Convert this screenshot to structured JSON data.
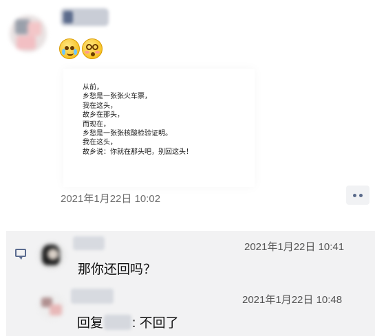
{
  "post": {
    "avatar_icon": "user-avatar-icon",
    "emojis": [
      "crying-face-icon",
      "dizzy-face-icon"
    ],
    "poem_lines": [
      "从前，",
      "乡愁是一张张火车票，",
      "我在这头，",
      "故乡在那头，",
      "而现在，",
      "乡愁是一张张核酸检验证明。",
      "我在这头，",
      "故乡说：你就在那头吧，别回这头！"
    ],
    "timestamp": "2021年1月22日 10:02",
    "more_button_icon": "more-dots-icon"
  },
  "comments": {
    "icon": "comment-icon",
    "items": [
      {
        "timestamp": "2021年1月22日 10:41",
        "text": "那你还回吗？"
      },
      {
        "timestamp": "2021年1月22日 10:48",
        "reply_prefix": "回复",
        "reply_suffix": ": 不回了"
      }
    ]
  }
}
